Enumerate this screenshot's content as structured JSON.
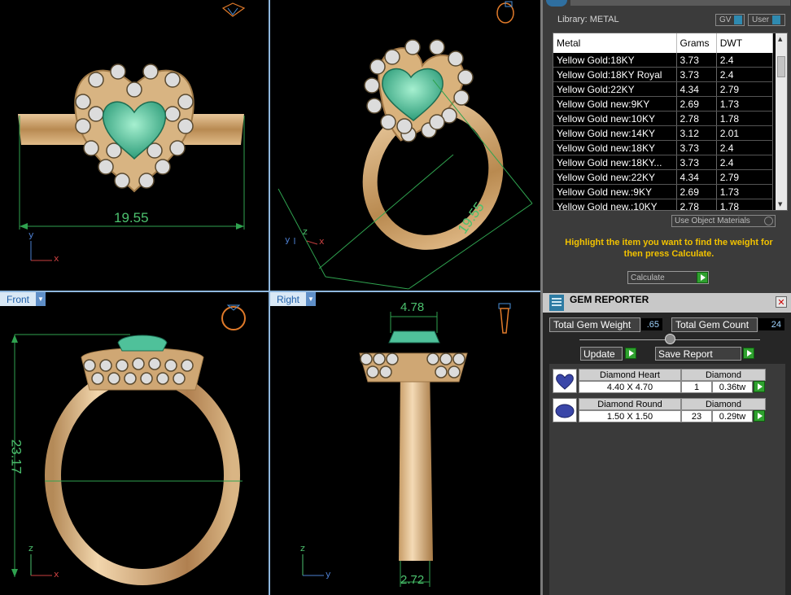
{
  "viewports": {
    "top": {
      "dimension": "19.55",
      "axes": {
        "a": "y",
        "b": "x"
      }
    },
    "perspective": {
      "dimension": "19.55",
      "axes": {
        "a": "y",
        "b": "x",
        "c": "z"
      }
    },
    "front": {
      "label": "Front",
      "dimension_v": "23.17",
      "axes": {
        "a": "z",
        "b": "x"
      }
    },
    "right": {
      "label": "Right",
      "dimension_top": "4.78",
      "dimension_bottom": "2.72",
      "axes": {
        "a": "z",
        "b": "y"
      }
    }
  },
  "library": {
    "title": "Library: METAL",
    "gv_label": "GV",
    "user_label": "User",
    "columns": [
      "Metal",
      "Grams",
      "DWT"
    ],
    "rows": [
      [
        "Yellow Gold:18KY",
        "3.73",
        "2.4"
      ],
      [
        "Yellow Gold:18KY Royal",
        "3.73",
        "2.4"
      ],
      [
        "Yellow Gold:22KY",
        "4.34",
        "2.79"
      ],
      [
        "Yellow Gold new:9KY",
        "2.69",
        "1.73"
      ],
      [
        "Yellow Gold new:10KY",
        "2.78",
        "1.78"
      ],
      [
        "Yellow Gold new:14KY",
        "3.12",
        "2.01"
      ],
      [
        "Yellow Gold new:18KY",
        "3.73",
        "2.4"
      ],
      [
        "Yellow Gold new:18KY...",
        "3.73",
        "2.4"
      ],
      [
        "Yellow Gold new:22KY",
        "4.34",
        "2.79"
      ],
      [
        "Yellow Gold new.:9KY",
        "2.69",
        "1.73"
      ],
      [
        "Yellow Gold new.:10KY",
        "2.78",
        "1.78"
      ]
    ],
    "use_object_materials": "Use Object Materials",
    "hint": "Highlight the item you want to find the weight for then press Calculate.",
    "calculate": "Calculate"
  },
  "gem_reporter": {
    "title": "GEM REPORTER",
    "total_weight_label": "Total Gem Weight",
    "total_weight": ".65",
    "total_count_label": "Total Gem Count",
    "total_count": "24",
    "update": "Update",
    "save_report": "Save Report",
    "gems": [
      {
        "name": "Diamond Heart",
        "material": "Diamond",
        "size": "4.40 X 4.70",
        "count": "1",
        "weight": "0.36tw"
      },
      {
        "name": "Diamond Round",
        "material": "Diamond",
        "size": "1.50 X 1.50",
        "count": "23",
        "weight": "0.29tw"
      }
    ]
  },
  "colors": {
    "gold": "#c9a06a",
    "emerald": "#55c9a0",
    "dimension": "#4cc16e",
    "accent": "#f2c200"
  }
}
